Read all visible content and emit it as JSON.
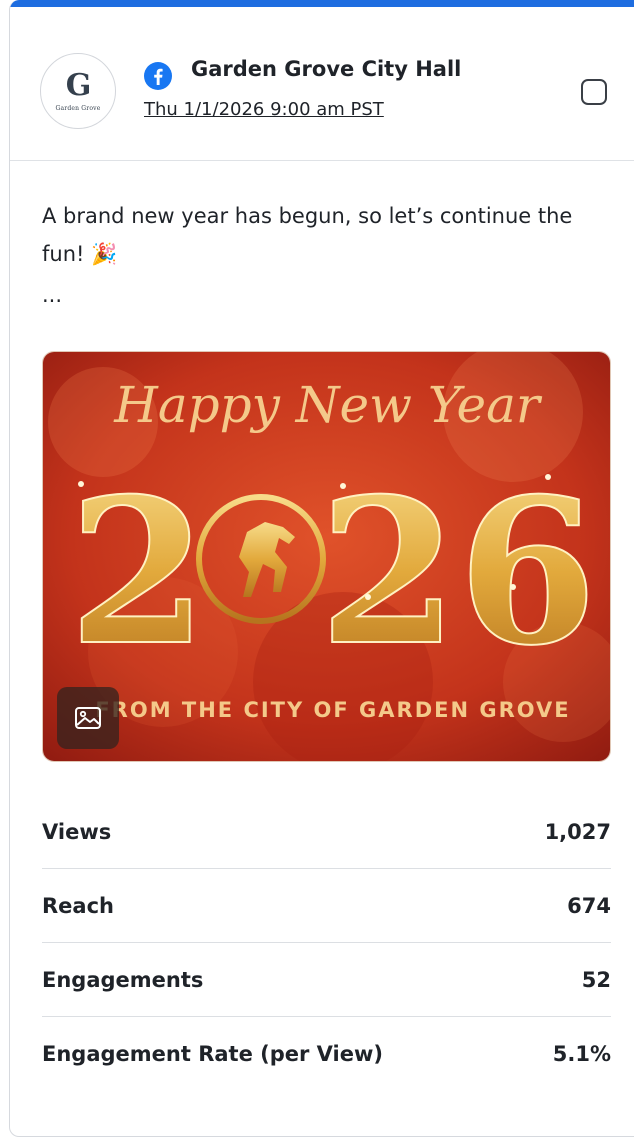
{
  "post": {
    "page_name": "Garden Grove City Hall",
    "timestamp": "Thu 1/1/2026 9:00 am PST",
    "avatar": {
      "logo_letter": "G",
      "logo_text": "Garden Grove"
    },
    "network_icon": "facebook-icon",
    "text": "A brand new year has begun, so let’s continue the fun! 🎉",
    "more": "...",
    "image": {
      "title_script": "Happy New Year",
      "year_left": "2",
      "year_right": "26",
      "footer": "FROM THE CITY OF GARDEN GROVE",
      "badge_icon": "image-icon"
    }
  },
  "stats": [
    {
      "label": "Views",
      "value": "1,027"
    },
    {
      "label": "Reach",
      "value": "674"
    },
    {
      "label": "Engagements",
      "value": "52"
    },
    {
      "label": "Engagement Rate (per View)",
      "value": "5.1%"
    }
  ],
  "colors": {
    "accent": "#1e6de0",
    "facebook": "#1877f2",
    "image_bg": "#c8341c",
    "gold": "#e8b84a"
  }
}
